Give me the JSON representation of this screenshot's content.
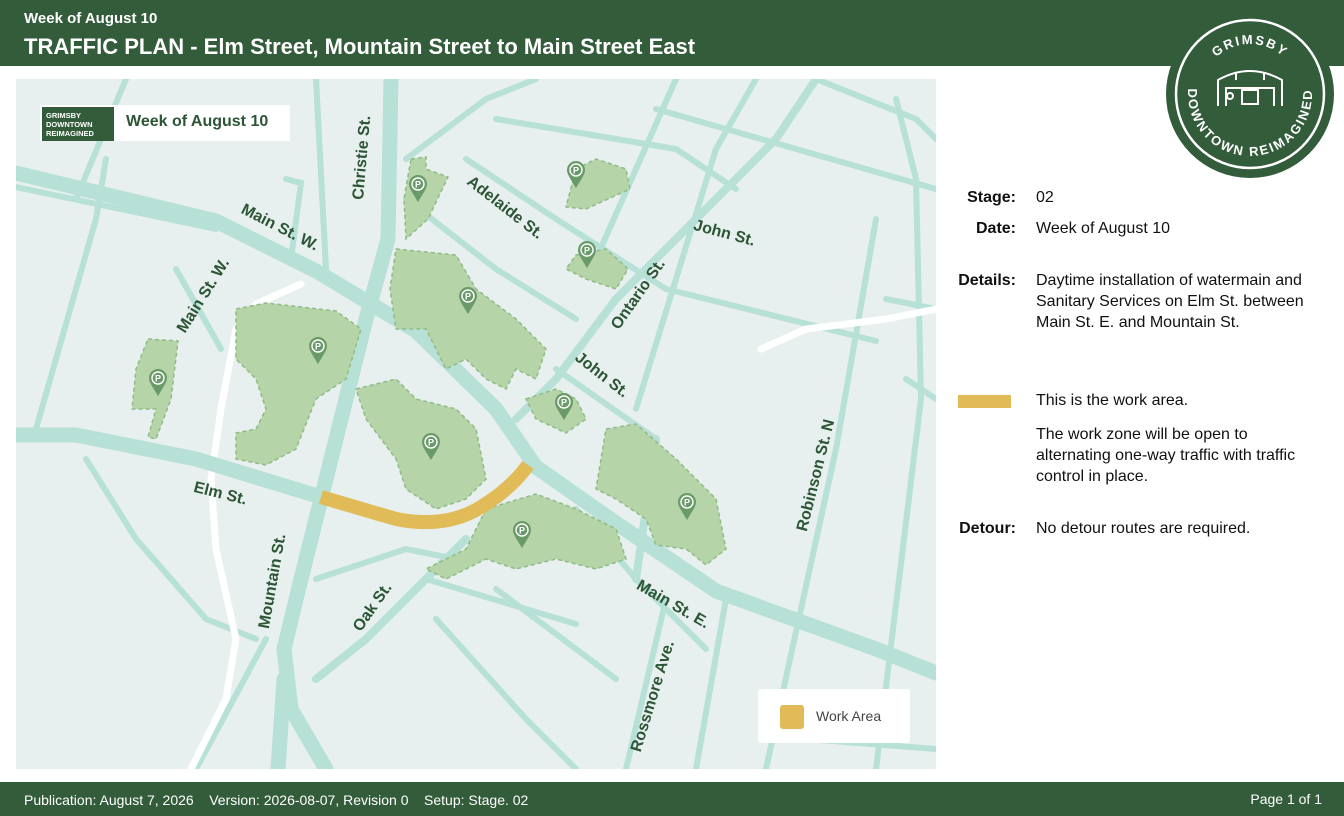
{
  "header": {
    "week": "Week of August 10",
    "title": "TRAFFIC PLAN - Elm Street, Mountain Street to Main Street East"
  },
  "logo": {
    "text_top": "GRIMSBY",
    "text_bottom": "DOWNTOWN REIMAGINED"
  },
  "map": {
    "banner": {
      "logo_lines": [
        "GRIMSBY",
        "DOWNTOWN",
        "REIMAGINED"
      ],
      "text": "Week of August 10"
    },
    "streets": {
      "christie": "Christie St.",
      "main_w_1": "Main St. W.",
      "main_w_2": "Main St. W.",
      "adelaide": "Adelaide St.",
      "john_1": "John St.",
      "john_2": "John St.",
      "ontario": "Ontario St.",
      "elm": "Elm St.",
      "mountain": "Mountain St.",
      "oak": "Oak St.",
      "main_e": "Main St. E.",
      "rossmore": "Rossmore Ave.",
      "robinson": "Robinson St. N"
    },
    "parking_icon": "parking-pin-icon",
    "legend": {
      "label": "Work Area",
      "color": "#e0bb57"
    }
  },
  "info": {
    "stage_label": "Stage:",
    "stage_value": "02",
    "date_label": "Date:",
    "date_value": "Week of August 10",
    "details_label": "Details:",
    "details_value": "Daytime installation of watermain and Sanitary Services on Elm St. between Main St. E. and Mountain St.",
    "work_area_text": "This is the work area.",
    "work_zone_text": "The work zone will be open to alternating one-way traffic with traffic control in place.",
    "detour_label": "Detour:",
    "detour_value": "No detour routes are required."
  },
  "footer": {
    "left": "Publication: August 7, 2026    Version: 2026-08-07, Revision 0    Setup: Stage. 02",
    "right": "Page 1 of 1"
  },
  "colors": {
    "brand_green": "#335c3b",
    "map_bg": "#e7f0ee",
    "road": "#b7e0d7",
    "parking_fill": "#b5d4a8",
    "work_area": "#e0bb57"
  }
}
